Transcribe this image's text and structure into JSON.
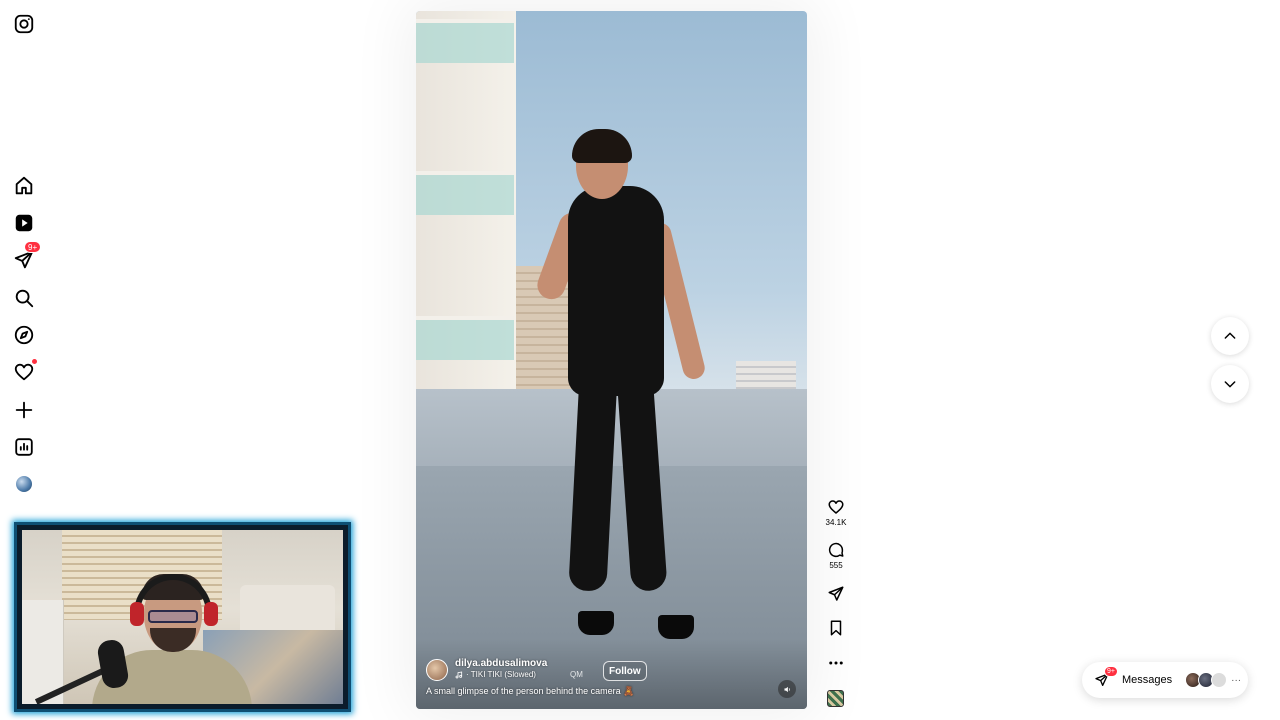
{
  "sidebar": {
    "items": [
      {
        "name": "instagram-logo-icon"
      },
      {
        "name": "home-icon"
      },
      {
        "name": "reels-icon"
      },
      {
        "name": "direct-messages-icon",
        "badge": "9+"
      },
      {
        "name": "search-icon"
      },
      {
        "name": "explore-icon"
      },
      {
        "name": "notifications-icon"
      },
      {
        "name": "create-icon"
      },
      {
        "name": "dashboard-icon"
      },
      {
        "name": "profile-avatar"
      }
    ]
  },
  "reel": {
    "author": "dilya.abdusalimova",
    "audio": "· TIKI TIKI (Slowed)",
    "audio_prefix": "QM",
    "follow_label": "Follow",
    "caption": "A small glimpse of the person behind the camera 🧸"
  },
  "actions": {
    "likes": "34.1K",
    "comments": "555"
  },
  "messages": {
    "label": "Messages",
    "badge": "9+",
    "more": "···"
  },
  "colors": {
    "badge": "#ff3040",
    "webcam_glow": "#1fa2d8"
  }
}
